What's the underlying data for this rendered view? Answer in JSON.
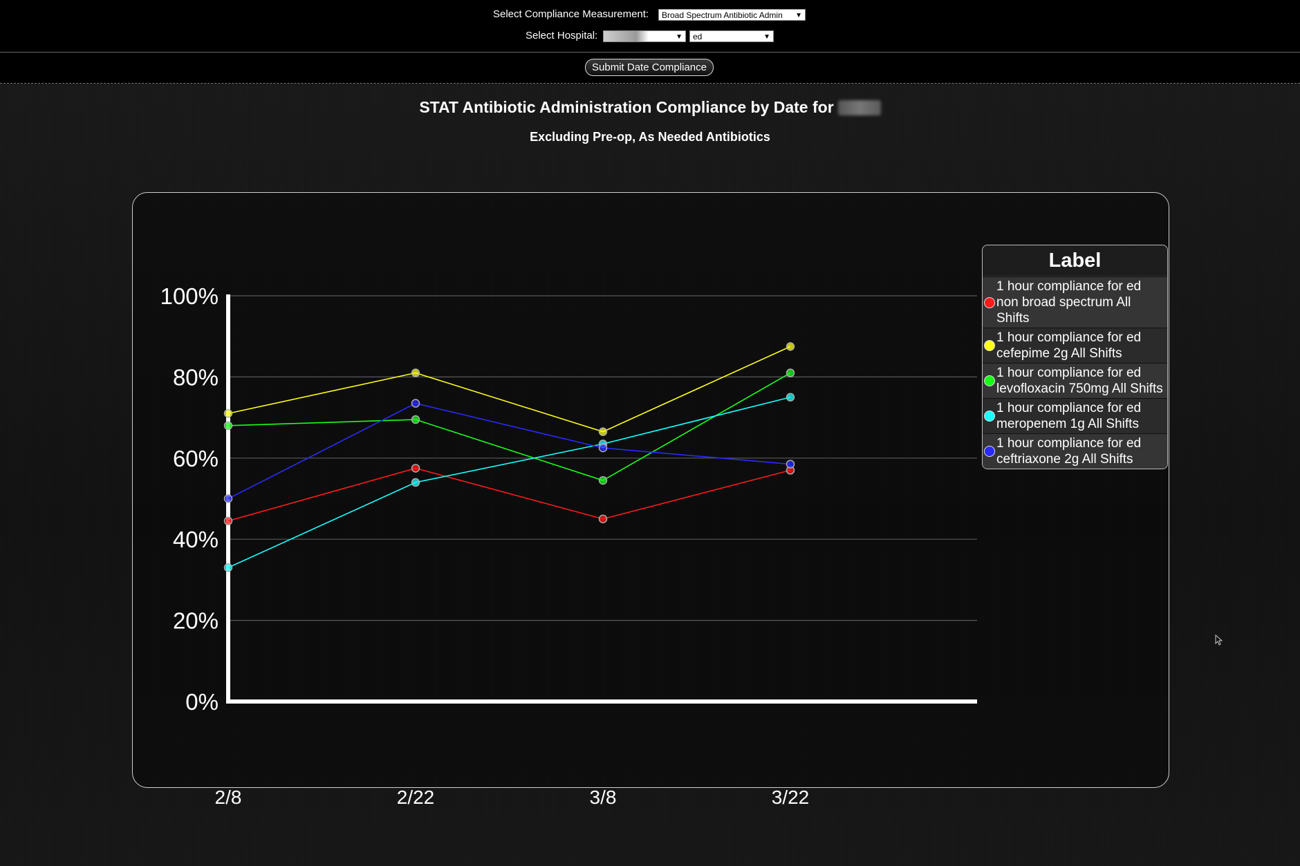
{
  "controls": {
    "measurement_label": "Select Compliance Measurement:",
    "measurement_value": "Broad Spectrum Antibiotic Admin",
    "hospital_label": "Select Hospital:",
    "hospital_value": "",
    "unit_value": "ed",
    "submit_label": "Submit Date Compliance"
  },
  "chart_data": {
    "type": "line",
    "title": "STAT Antibiotic Administration Compliance by Date for",
    "subtitle": "Excluding Pre-op, As Needed Antibiotics",
    "categories": [
      "2/8",
      "2/22",
      "3/8",
      "3/22"
    ],
    "yticks": [
      "100%",
      "80%",
      "60%",
      "40%",
      "20%",
      "0%"
    ],
    "ylim": [
      0,
      100
    ],
    "grid": true,
    "legend_title": "Label",
    "legend_position": "right",
    "series": [
      {
        "name": "1 hour compliance for ed non broad spectrum All Shifts",
        "color": "#ff1a1a",
        "values": [
          44.5,
          57.5,
          45,
          57
        ]
      },
      {
        "name": "1 hour compliance for ed cefepime 2g All Shifts",
        "color": "#ffff1a",
        "values": [
          71,
          81,
          66.5,
          87.5
        ]
      },
      {
        "name": "1 hour compliance for ed levofloxacin 750mg All Shifts",
        "color": "#1aff1a",
        "values": [
          68,
          69.5,
          54.5,
          81
        ]
      },
      {
        "name": "1 hour compliance for ed meropenem 1g All Shifts",
        "color": "#1affff",
        "values": [
          33,
          54,
          63.5,
          75
        ]
      },
      {
        "name": "1 hour compliance for ed ceftriaxone 2g All Shifts",
        "color": "#2a2aff",
        "values": [
          50,
          73.5,
          62.5,
          58.5
        ]
      }
    ]
  }
}
